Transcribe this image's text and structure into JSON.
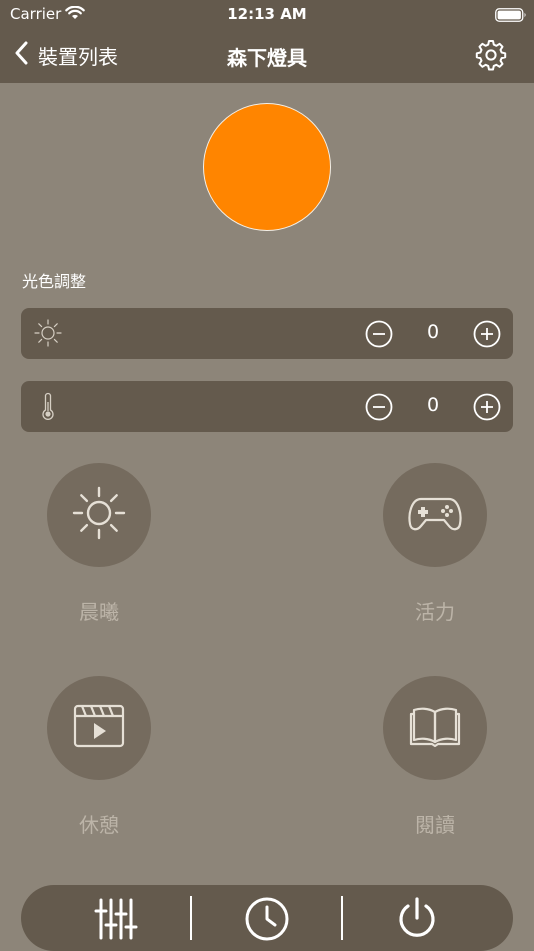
{
  "status_bar": {
    "carrier": "Carrier",
    "time": "12:13 AM"
  },
  "nav": {
    "back_label": "裝置列表",
    "title": "森下燈具"
  },
  "light": {
    "color": "#ff8500"
  },
  "adjust": {
    "section_label": "光色調整",
    "brightness": {
      "icon": "sun-icon",
      "value": "0"
    },
    "temperature": {
      "icon": "thermometer-icon",
      "value": "0"
    }
  },
  "scenes": [
    {
      "label": "晨曦",
      "icon": "sun-icon"
    },
    {
      "label": "活力",
      "icon": "gamepad-icon"
    },
    {
      "label": "休憩",
      "icon": "film-icon"
    },
    {
      "label": "閱讀",
      "icon": "book-icon"
    }
  ],
  "bottom_bar": {
    "buttons": [
      "sliders-icon",
      "clock-icon",
      "power-icon"
    ]
  },
  "colors": {
    "nav_background": "#645a4d",
    "page_background": "#8d8579",
    "scene_circle": "#756b5e",
    "accent_light": "#ff8500"
  }
}
